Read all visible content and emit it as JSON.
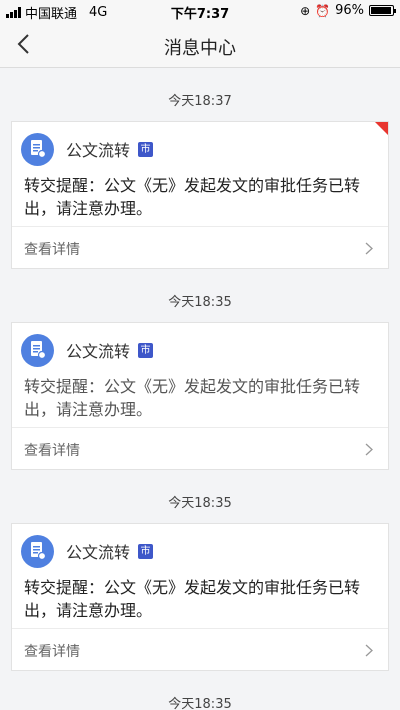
{
  "status_bar": {
    "carrier": "中国联通",
    "network": "4G",
    "time": "下午7:37",
    "battery": "96%",
    "battery_level": 0.96
  },
  "nav": {
    "title": "消息中心",
    "back_icon": "chevron-left-icon"
  },
  "messages": [
    {
      "time": "今天18:37",
      "app_name": "公文流转",
      "tag": "市",
      "text": "转交提醒：公文《无》发起发文的审批任务已转出，请注意办理。",
      "detail_label": "查看详情",
      "unread": true
    },
    {
      "time": "今天18:35",
      "app_name": "公文流转",
      "tag": "市",
      "text": "转交提醒：公文《无》发起发文的审批任务已转出，请注意办理。",
      "detail_label": "查看详情",
      "unread": false
    },
    {
      "time": "今天18:35",
      "app_name": "公文流转",
      "tag": "市",
      "text": "转交提醒：公文《无》发起发文的审批任务已转出，请注意办理。",
      "detail_label": "查看详情",
      "unread": false
    },
    {
      "time": "今天18:35"
    }
  ],
  "colors": {
    "accent": "#4f80e0",
    "tag": "#3e57c9",
    "unread_flag": "#e8352f"
  }
}
